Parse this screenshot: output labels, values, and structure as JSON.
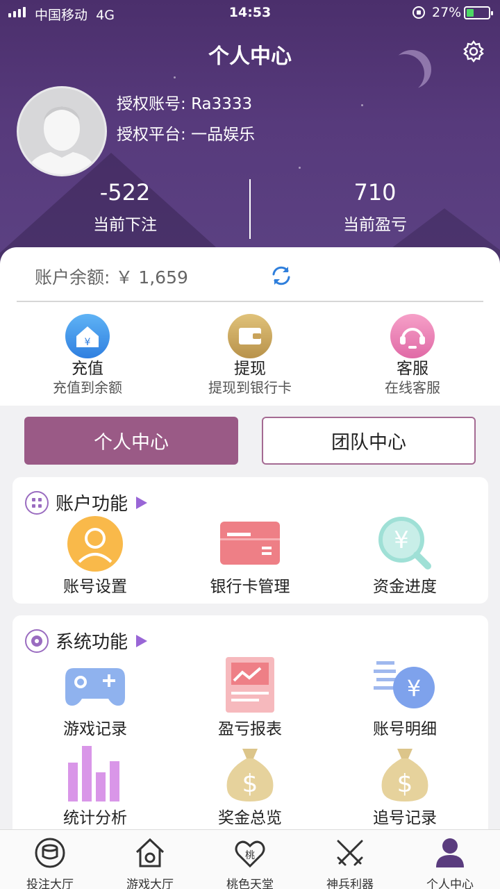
{
  "status_bar": {
    "carrier": "中国移动",
    "network": "4G",
    "time": "14:53",
    "battery": "27%"
  },
  "header": {
    "title": "个人中心"
  },
  "profile": {
    "account_label": "授权账号: ",
    "account_value": "Ra3333",
    "platform_label": "授权平台: ",
    "platform_value": "一品娱乐"
  },
  "stats": {
    "bet": {
      "value": "-522",
      "label": "当前下注"
    },
    "profit": {
      "value": "710",
      "label": "当前盈亏"
    }
  },
  "balance": {
    "label": "账户余额: ",
    "value": "￥ 1,659"
  },
  "quick_actions": [
    {
      "title": "充值",
      "subtitle": "充值到余额",
      "icon": "recharge-icon"
    },
    {
      "title": "提现",
      "subtitle": "提现到银行卡",
      "icon": "wallet-icon"
    },
    {
      "title": "客服",
      "subtitle": "在线客服",
      "icon": "headset-icon"
    }
  ],
  "segments": {
    "personal": "个人中心",
    "team": "团队中心"
  },
  "account_functions": {
    "title": "账户功能",
    "items": [
      {
        "label": "账号设置",
        "icon": "user-settings-icon"
      },
      {
        "label": "银行卡管理",
        "icon": "bank-card-icon"
      },
      {
        "label": "资金进度",
        "icon": "fund-search-icon"
      }
    ]
  },
  "system_functions": {
    "title": "系统功能",
    "items": [
      {
        "label": "游戏记录",
        "icon": "gamepad-icon"
      },
      {
        "label": "盈亏报表",
        "icon": "report-icon"
      },
      {
        "label": "账号明细",
        "icon": "account-detail-icon"
      },
      {
        "label": "统计分析",
        "icon": "bar-stats-icon"
      },
      {
        "label": "奖金总览",
        "icon": "money-bag-icon"
      },
      {
        "label": "追号记录",
        "icon": "money-bag-icon"
      }
    ]
  },
  "tabs": [
    {
      "label": "投注大厅",
      "icon": "betting-hall-icon"
    },
    {
      "label": "游戏大厅",
      "icon": "home-icon"
    },
    {
      "label": "桃色天堂",
      "icon": "peach-heart-icon"
    },
    {
      "label": "神兵利器",
      "icon": "crossed-swords-icon"
    },
    {
      "label": "个人中心",
      "icon": "user-icon",
      "active": true
    }
  ],
  "colors": {
    "header_purple": "#553878",
    "accent": "#9a5a86",
    "active_tab": "#5a3c7e"
  }
}
